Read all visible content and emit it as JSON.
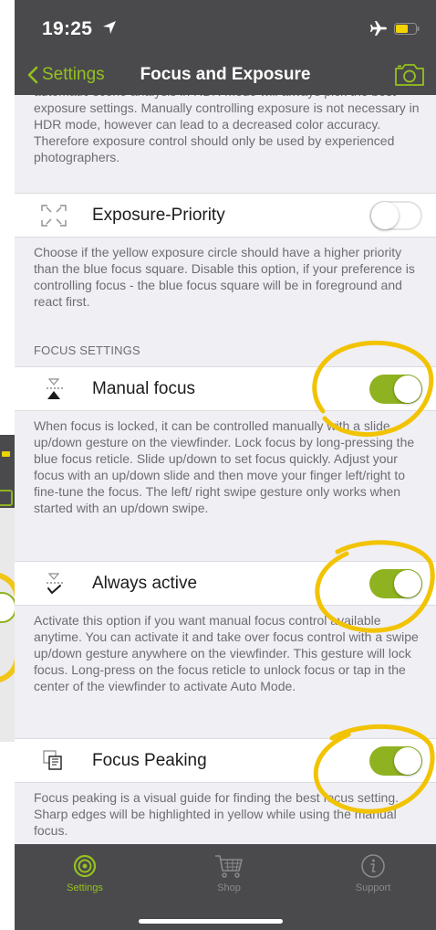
{
  "status": {
    "time": "19:25"
  },
  "nav": {
    "back_label": "Settings",
    "title": "Focus and Exposure"
  },
  "content": {
    "intro_text": "automatic scene analysis in HDR mode will always pick the best exposure settings. Manually controlling exposure is not necessary in HDR mode, however can lead to a decreased color accuracy. Therefore exposure control should only be used by experienced photographers.",
    "exposure_priority": {
      "label": "Exposure-Priority",
      "enabled": false,
      "desc": "Choose if the yellow exposure circle should have a higher priority than the blue focus square. Disable this option, if your preference is controlling focus - the blue focus square will be in foreground and react first."
    },
    "focus_section_header": "FOCUS SETTINGS",
    "manual_focus": {
      "label": "Manual focus",
      "enabled": true,
      "desc": "When focus is locked, it can be controlled manually with a slide up/down gesture on the viewfinder. Lock focus by long-pressing the blue focus reticle. Slide up/down to set focus quickly. Adjust your focus with an up/down slide and then move your finger left/right to fine-tune the focus. The left/ right swipe gesture only works when started with an up/down swipe."
    },
    "always_active": {
      "label": "Always active",
      "enabled": true,
      "desc": "Activate this option if you want manual focus control available anytime. You can activate it and take over focus control with a swipe up/down gesture anywhere on the viewfinder. This gesture will lock focus. Long-press on the focus reticle to unlock focus or tap in the center of the viewfinder to activate Auto Mode."
    },
    "focus_peaking": {
      "label": "Focus Peaking",
      "enabled": true,
      "desc": "Focus peaking is a visual guide for finding the best focus setting. Sharp edges will be highlighted in yellow while using the manual focus."
    }
  },
  "tabs": [
    {
      "label": "Settings",
      "active": true,
      "icon": "gear-icon"
    },
    {
      "label": "Shop",
      "active": false,
      "icon": "cart-icon"
    },
    {
      "label": "Support",
      "active": false,
      "icon": "info-icon"
    }
  ],
  "colors": {
    "accent": "#96C11F",
    "toggle_on": "#8FB320",
    "bar_bg": "#4A4A4C",
    "annotation": "#F2C300",
    "inactive_tab": "#8A8A8E"
  }
}
